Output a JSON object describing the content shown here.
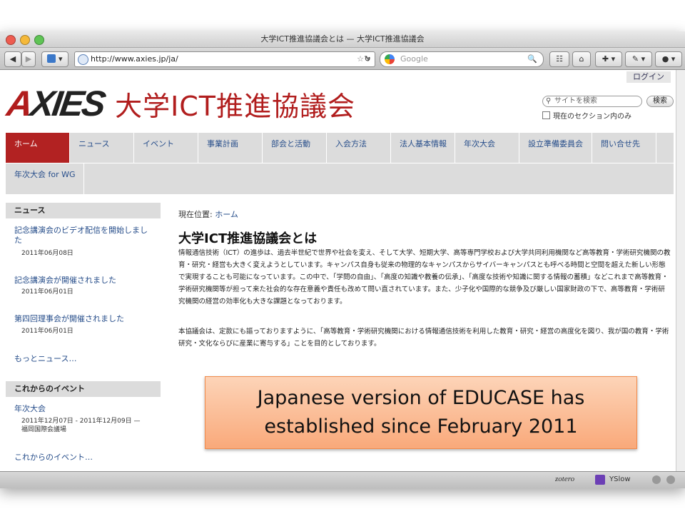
{
  "window": {
    "title": "大学ICT推進協議会とは — 大学ICT推進協議会"
  },
  "toolbar": {
    "back_label": "◀",
    "forward_label": "▶",
    "url": "http://www.axies.jp/ja/",
    "search_placeholder": "Google",
    "search_icon": "🔍",
    "url_controls": "☆ ▾"
  },
  "site": {
    "login_label": "ログイン",
    "logo_mark_x": "X",
    "logo_mark_a": "A",
    "logo_mark_rest": "IES",
    "logo_japanese": "大学ICT推進協議会",
    "search_placeholder": "サイトを検索",
    "search_button": "検索",
    "search_section_only": "現在のセクション内のみ"
  },
  "nav": {
    "items": [
      {
        "label": "ホーム"
      },
      {
        "label": "ニュース"
      },
      {
        "label": "イベント"
      },
      {
        "label": "事業計画"
      },
      {
        "label": "部会と活動"
      },
      {
        "label": "入会方法"
      },
      {
        "label": "法人基本情報"
      },
      {
        "label": "年次大会"
      },
      {
        "label": "設立準備委員会"
      },
      {
        "label": "問い合せ先"
      }
    ],
    "row2_item": "年次大会 for WG"
  },
  "sidebar": {
    "news_heading": "ニュース",
    "news": [
      {
        "title": "記念講演会のビデオ配信を開始しました",
        "date": "2011年06月08日"
      },
      {
        "title": "記念講演会が開催されました",
        "date": "2011年06月01日"
      },
      {
        "title": "第四回理事会が開催されました",
        "date": "2011年06月01日"
      }
    ],
    "more_news": "もっとニュース…",
    "events_heading": "これからのイベント",
    "event_title": "年次大会",
    "event_date": "2011年12月07日 - 2011年12月09日 —",
    "event_place": "福岡国際会議場",
    "more_events": "これからのイベント…"
  },
  "main": {
    "breadcrumb_prefix": "現在位置:",
    "breadcrumb_home": "ホーム",
    "title": "大学ICT推進協議会とは",
    "para1": "情報通信技術（ICT）の進歩は、過去半世紀で世界や社会を変え、そして大学、短期大学、高等専門学校および大学共同利用機関など高等教育・学術研究機関の教育・研究・経営も大きく変えようとしています。キャンパス自身も従来の物理的なキャンパスからサイバーキャンパスとも呼べる時間と空間を超えた新しい形態で実現することも可能になっています。この中で、「学問の自由」、「高度の知識や教養の伝承」、「高度な技術や知識に関する情報の蓄積」などこれまで高等教育・学術研究機関等が担って来た社会的な存在意義や責任も改めて問い直されています。また、少子化や国際的な競争及び厳しい国家財政の下で、高等教育・学術研究機関の経営の効率化も大きな課題となっております。",
    "para2": "本協議会は、定款にも謳っておりますように、「高等教育・学術研究機関における情報通信技術を利用した教育・研究・経営の高度化を図り、我が国の教育・学術研究・文化ならびに産業に寄与する」ことを目的としております。"
  },
  "statusbar": {
    "zotero": "zotero",
    "yslow": "YSlow"
  },
  "callout": {
    "line1": "Japanese version of EDUCASE has",
    "line2": "established since February 2011"
  },
  "colors": {
    "brand_red": "#b22222",
    "link_blue": "#264d8a",
    "callout_orange": "#f9a97a"
  }
}
